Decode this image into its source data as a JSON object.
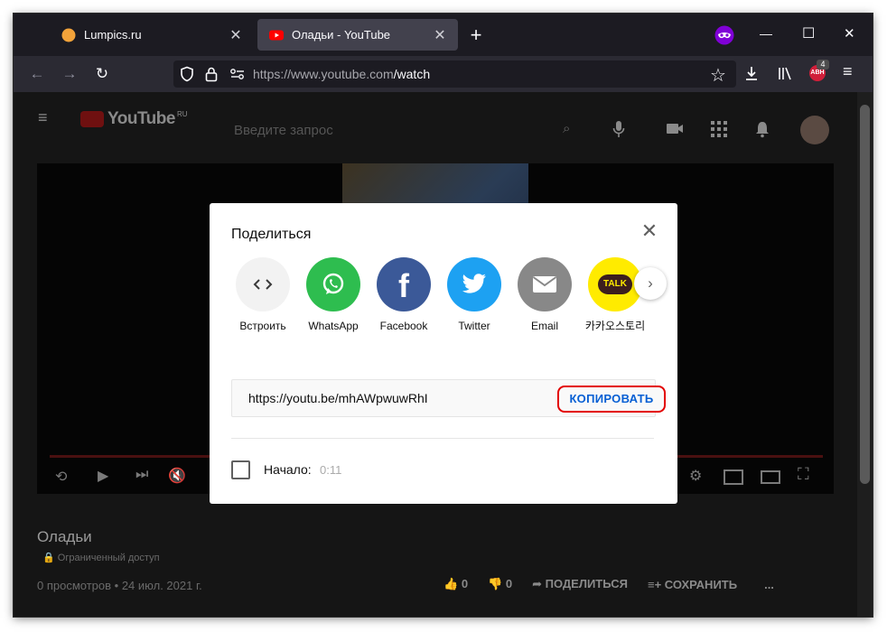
{
  "browser": {
    "tabs": [
      {
        "title": "Lumpics.ru",
        "favicon_color": "#f3a33a"
      },
      {
        "title": "Оладьи - YouTube",
        "favicon_color": "#ff0000"
      }
    ],
    "new_tab_symbol": "+",
    "url_host": "https://www.youtube.com",
    "url_path": "/watch",
    "addon_badge": "4",
    "addon_label": "ABH",
    "private_mask_color": "#8000d7",
    "window_controls": {
      "minimize": "—",
      "maximize": "☐",
      "close": "✕"
    }
  },
  "youtube": {
    "logo_text": "YouTube",
    "region": "RU",
    "search_placeholder": "Введите запрос",
    "video_title": "Оладьи",
    "privacy": "Ограниченный доступ",
    "meta": "0 просмотров • 24 июл. 2021 г.",
    "likes": "0",
    "dislikes": "0",
    "share_label": "ПОДЕЛИТЬСЯ",
    "save_label": "СОХРАНИТЬ",
    "more": "..."
  },
  "share_dialog": {
    "title": "Поделиться",
    "targets": [
      {
        "label": "Встроить",
        "icon": "embed-icon",
        "color": "#f2f2f2"
      },
      {
        "label": "WhatsApp",
        "icon": "whatsapp-icon",
        "color": "#2ebd4f"
      },
      {
        "label": "Facebook",
        "icon": "facebook-icon",
        "color": "#3b5998"
      },
      {
        "label": "Twitter",
        "icon": "twitter-icon",
        "color": "#1da1f2"
      },
      {
        "label": "Email",
        "icon": "email-icon",
        "color": "#888888"
      },
      {
        "label": "카카오스토리",
        "icon": "kakao-talk-icon",
        "color": "#ffeb00"
      }
    ],
    "kakao_badge_text": "TALK",
    "link": "https://youtu.be/mhAWpwuwRhI",
    "copy_label": "КОПИРОВАТЬ",
    "start_label": "Начало:",
    "start_time": "0:11",
    "highlight_color": "#e30000"
  }
}
